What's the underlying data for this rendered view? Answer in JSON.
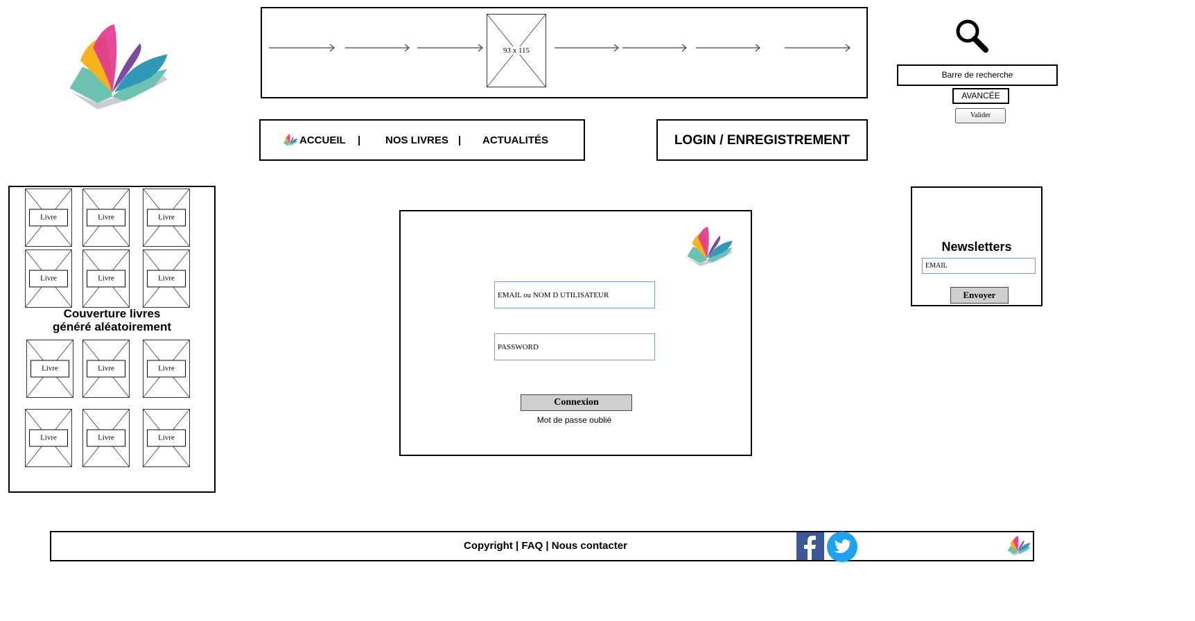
{
  "carousel": {
    "placeholder_label": "93 x 115"
  },
  "search": {
    "bar_label": "Barre de recherche",
    "advanced_label": "AVANCÉE",
    "submit_label": "Valider"
  },
  "nav": {
    "items": [
      {
        "label": "ACCUEIL"
      },
      {
        "label": "NOS LIVRES"
      },
      {
        "label": "ACTUALITÉS"
      }
    ],
    "separator": "|",
    "login_label": "LOGIN / ENREGISTREMENT"
  },
  "sidebar": {
    "caption_line1": "Couverture livres",
    "caption_line2": "généré aléatoirement",
    "book_label": "Livre",
    "book_labels": [
      "Livre",
      "Livre",
      "Livre",
      "Livre",
      "Livre",
      "Livre",
      "Livre",
      "Livre",
      "Livre",
      "Livre",
      "Livre",
      "Livre"
    ]
  },
  "login_form": {
    "username_placeholder": "EMAIL ou NOM D UTILISATEUR",
    "password_placeholder": "PASSWORD",
    "submit_label": "Connexion",
    "forgot_label": "Mot de passe oublié"
  },
  "newsletter": {
    "title": "Newsletters",
    "email_placeholder": "EMAIL",
    "submit_label": "Envoyer"
  },
  "footer": {
    "copyright": "Copyright",
    "faq": "FAQ",
    "contact": "Nous contacter",
    "separator": "|"
  },
  "colors": {
    "field_border": "#7a9cc6",
    "facebook": "#3b5998",
    "twitter": "#1da1f2",
    "button_gray": "#cfcfcf"
  }
}
